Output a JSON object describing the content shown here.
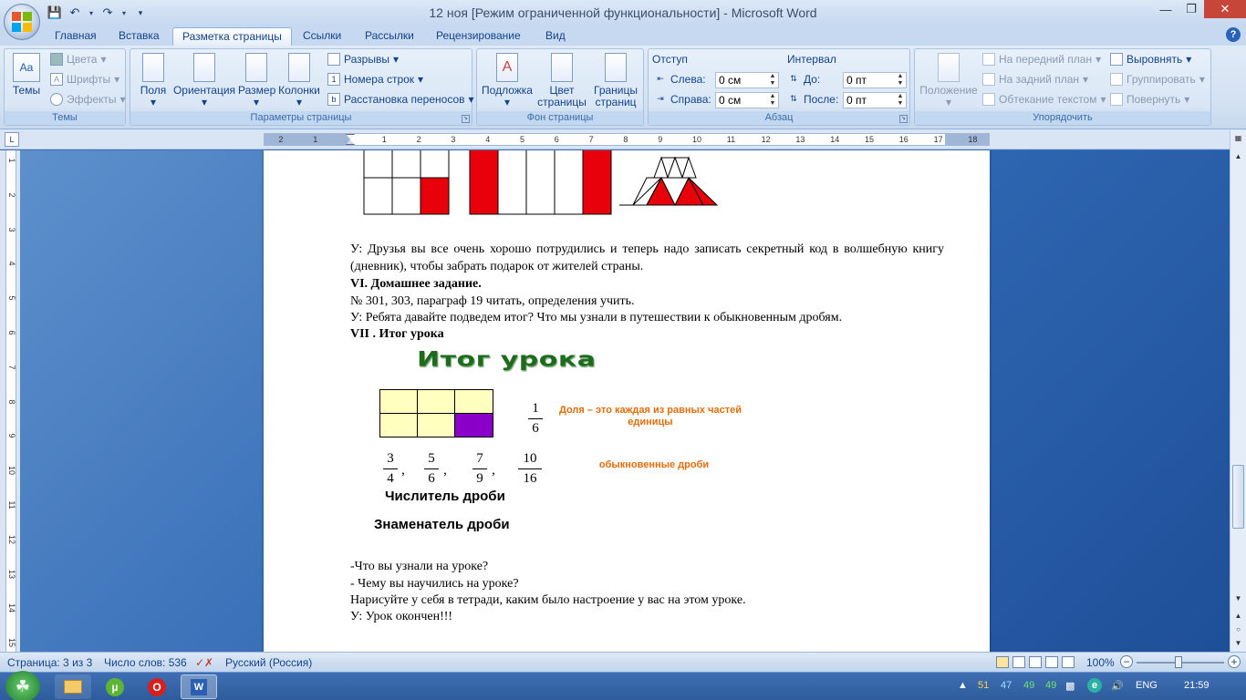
{
  "window": {
    "title": "12 ноя [Режим ограниченной функциональности] - Microsoft Word"
  },
  "tabs": [
    "Главная",
    "Вставка",
    "Разметка страницы",
    "Ссылки",
    "Рассылки",
    "Рецензирование",
    "Вид"
  ],
  "active_tab": "Разметка страницы",
  "ribbon": {
    "themes": {
      "label": "Темы",
      "big": "Темы",
      "colors": "Цвета",
      "fonts": "Шрифты",
      "effects": "Эффекты"
    },
    "page_setup": {
      "label": "Параметры страницы",
      "margins": "Поля",
      "orientation": "Ориентация",
      "size": "Размер",
      "columns": "Колонки",
      "breaks": "Разрывы",
      "line_numbers": "Номера строк",
      "hyphenation": "Расстановка переносов"
    },
    "page_background": {
      "label": "Фон страницы",
      "watermark": "Подложка",
      "page_color_1": "Цвет",
      "page_color_2": "страницы",
      "page_borders_1": "Границы",
      "page_borders_2": "страниц"
    },
    "paragraph": {
      "label": "Абзац",
      "indent": "Отступ",
      "left": "Слева:",
      "right": "Справа:",
      "left_value": "0 см",
      "right_value": "0 см",
      "spacing": "Интервал",
      "before": "До:",
      "after": "После:",
      "before_value": "0 пт",
      "after_value": "0 пт"
    },
    "arrange": {
      "label": "Упорядочить",
      "position": "Положение",
      "bring_front": "На передний план",
      "send_back": "На задний план",
      "text_wrap": "Обтекание текстом",
      "align": "Выровнять",
      "group": "Группировать",
      "rotate": "Повернуть"
    }
  },
  "ruler": {
    "numbers": [
      "2",
      "1",
      "1",
      "2",
      "3",
      "4",
      "5",
      "6",
      "7",
      "8",
      "9",
      "10",
      "11",
      "12",
      "13",
      "14",
      "15",
      "16",
      "17",
      "18"
    ],
    "vnumbers": [
      "1",
      "2",
      "3",
      "4",
      "5",
      "6",
      "7",
      "8",
      "9",
      "10",
      "11",
      "12",
      "13",
      "14",
      "15"
    ]
  },
  "document": {
    "para1": "У: Друзья вы все очень хорошо потрудились и теперь надо записать секретный код в волшебную книгу (дневник), чтобы забрать подарок от жителей страны.",
    "heading6": "VI. Домашнее задание.",
    "homework": "№   301, 303, параграф 19 читать, определения учить.",
    "para2": "У: Ребята давайте подведем итог? Что мы узнали в путешествии к обыкновенным дробям.",
    "heading7": "VII . Итог урока",
    "slide": {
      "title": "Итог урока",
      "frac_main": {
        "num": "1",
        "den": "6"
      },
      "definition": "Доля – это каждая из равных частей единицы",
      "fractions": [
        {
          "num": "3",
          "den": "4"
        },
        {
          "num": "5",
          "den": "6"
        },
        {
          "num": "7",
          "den": "9"
        },
        {
          "num": "10",
          "den": "16"
        }
      ],
      "common_label": "обыкновенные дроби",
      "numerator": "Числитель дроби",
      "denominator": "Знаменатель дроби",
      "comma": ","
    },
    "q1": "-Что вы узнали на уроке?",
    "q2": "- Чему вы научились на уроке?",
    "q3": "Нарисуйте у себя в тетради, каким было настроение у вас на этом уроке.",
    "end": "У: Урок окончен!!!"
  },
  "status": {
    "page": "Страница: 3 из 3",
    "words": "Число слов: 536",
    "language": "Русский (Россия)",
    "zoom": "100%"
  },
  "taskbar": {
    "lang": "ENG",
    "time": "21:59",
    "tray_nums": [
      "51",
      "47",
      "49",
      "49"
    ]
  },
  "colors": {
    "red": "#e8000b",
    "yellow": "#ffffc0",
    "purple": "#8a00c8",
    "orange": "#e46c0a",
    "green": "#1e6b1e"
  }
}
